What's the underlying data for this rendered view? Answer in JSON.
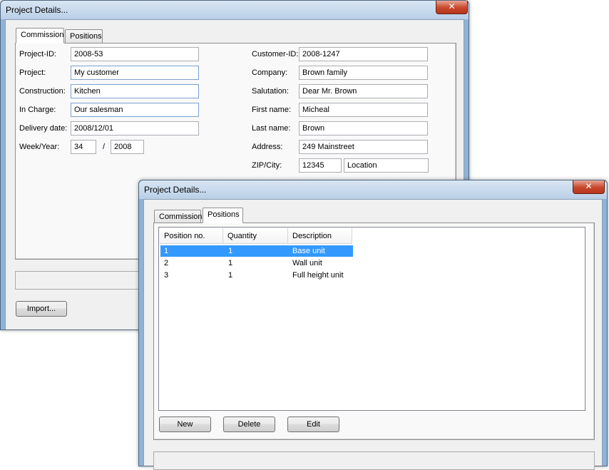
{
  "back_window": {
    "title": "Project Details...",
    "close_label": "✕",
    "tabs": [
      "Commission",
      "Positions"
    ],
    "left_fields": [
      {
        "label": "Project-ID:",
        "value": "2008-53"
      },
      {
        "label": "Project:",
        "value": "My customer"
      },
      {
        "label": "Construction:",
        "value": "Kitchen"
      },
      {
        "label": "In Charge:",
        "value": "Our salesman"
      },
      {
        "label": "Delivery date:",
        "value": "2008/12/01"
      }
    ],
    "week_year": {
      "label": "Week/Year:",
      "week": "34",
      "separator": "/",
      "year": "2008"
    },
    "right_fields": [
      {
        "label": "Customer-ID:",
        "value": "2008-1247"
      },
      {
        "label": "Company:",
        "value": "Brown family"
      },
      {
        "label": "Salutation:",
        "value": "Dear Mr. Brown"
      },
      {
        "label": "First name:",
        "value": "Micheal"
      },
      {
        "label": "Last name:",
        "value": "Brown"
      },
      {
        "label": "Address:",
        "value": "249 Mainstreet"
      }
    ],
    "zip_city": {
      "label": "ZIP/City:",
      "zip": "12345",
      "city": "Location"
    },
    "import_label": "Import..."
  },
  "front_window": {
    "title": "Project Details...",
    "close_label": "✕",
    "tabs": [
      "Commission",
      "Positions"
    ],
    "columns": [
      "Position no.",
      "Quantity",
      "Description"
    ],
    "rows": [
      {
        "pos": "1",
        "qty": "1",
        "desc": "Base unit",
        "selected": true
      },
      {
        "pos": "2",
        "qty": "1",
        "desc": "Wall unit",
        "selected": false
      },
      {
        "pos": "3",
        "qty": "1",
        "desc": "Full height unit",
        "selected": false
      }
    ],
    "buttons": {
      "new": "New",
      "delete": "Delete",
      "edit": "Edit"
    }
  },
  "colors": {
    "selection": "#3399ff",
    "close": "#c7472b",
    "frame": "#8fb3d6"
  }
}
